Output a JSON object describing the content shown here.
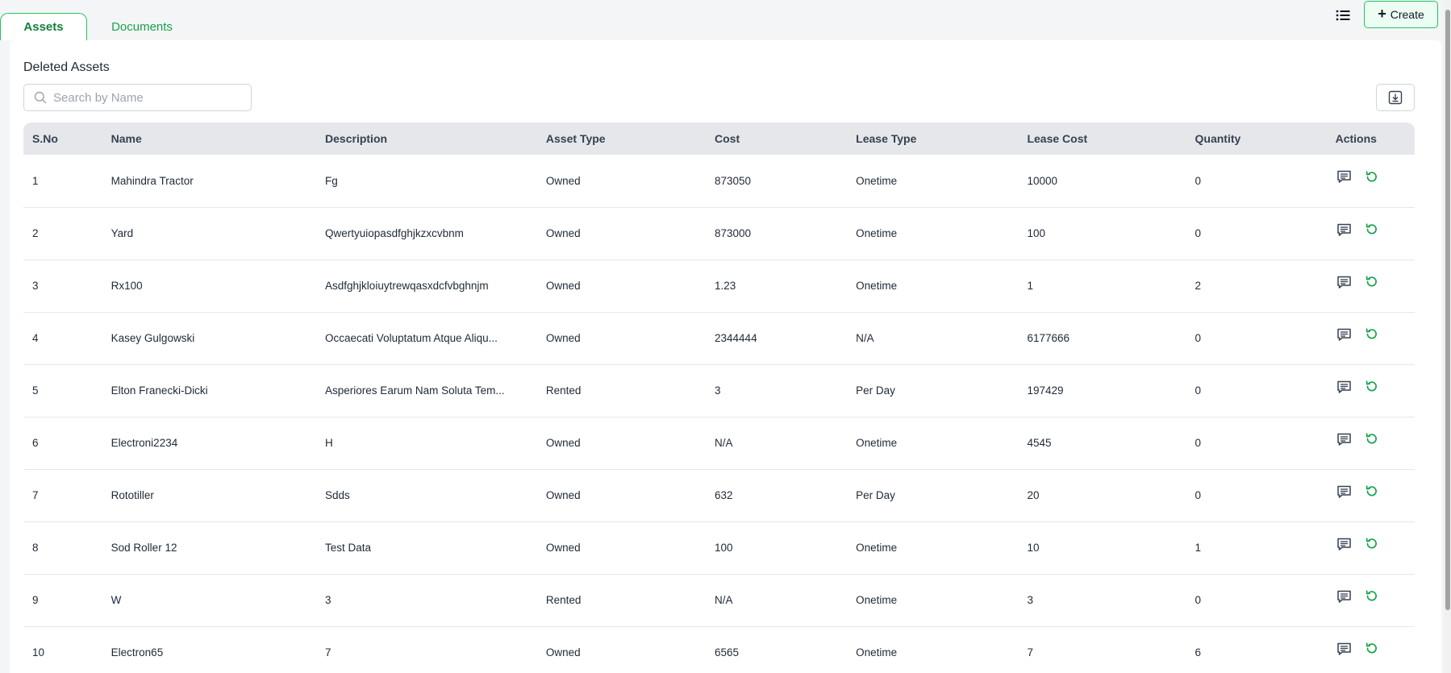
{
  "tabs": [
    {
      "label": "Assets",
      "active": true
    },
    {
      "label": "Documents",
      "active": false
    }
  ],
  "toolbar": {
    "create_label": "Create"
  },
  "panel": {
    "title": "Deleted Assets",
    "search_placeholder": "Search by Name"
  },
  "table": {
    "columns": [
      "S.No",
      "Name",
      "Description",
      "Asset Type",
      "Cost",
      "Lease Type",
      "Lease Cost",
      "Quantity",
      "Actions"
    ],
    "rows": [
      {
        "sno": "1",
        "name": "Mahindra Tractor",
        "description": "Fg",
        "asset_type": "Owned",
        "cost": "873050",
        "lease_type": "Onetime",
        "lease_cost": "10000",
        "quantity": "0"
      },
      {
        "sno": "2",
        "name": "Yard",
        "description": "Qwertyuiopasdfghjkzxcvbnm",
        "asset_type": "Owned",
        "cost": "873000",
        "lease_type": "Onetime",
        "lease_cost": "100",
        "quantity": "0"
      },
      {
        "sno": "3",
        "name": "Rx100",
        "description": "Asdfghjkloiuytrewqasxdcfvbghnjm",
        "asset_type": "Owned",
        "cost": "1.23",
        "lease_type": "Onetime",
        "lease_cost": "1",
        "quantity": "2"
      },
      {
        "sno": "4",
        "name": "Kasey Gulgowski",
        "description": "Occaecati Voluptatum Atque Aliqu...",
        "asset_type": "Owned",
        "cost": "2344444",
        "lease_type": "N/A",
        "lease_cost": "6177666",
        "quantity": "0"
      },
      {
        "sno": "5",
        "name": "Elton Franecki-Dicki",
        "description": "Asperiores Earum Nam Soluta Tem...",
        "asset_type": "Rented",
        "cost": "3",
        "lease_type": "Per Day",
        "lease_cost": "197429",
        "quantity": "0"
      },
      {
        "sno": "6",
        "name": "Electroni2234",
        "description": "H",
        "asset_type": "Owned",
        "cost": "N/A",
        "lease_type": "Onetime",
        "lease_cost": "4545",
        "quantity": "0"
      },
      {
        "sno": "7",
        "name": "Rototiller",
        "description": "Sdds",
        "asset_type": "Owned",
        "cost": "632",
        "lease_type": "Per Day",
        "lease_cost": "20",
        "quantity": "0"
      },
      {
        "sno": "8",
        "name": "Sod Roller 12",
        "description": "Test Data",
        "asset_type": "Owned",
        "cost": "100",
        "lease_type": "Onetime",
        "lease_cost": "10",
        "quantity": "1"
      },
      {
        "sno": "9",
        "name": "W",
        "description": "3",
        "asset_type": "Rented",
        "cost": "N/A",
        "lease_type": "Onetime",
        "lease_cost": "3",
        "quantity": "0"
      },
      {
        "sno": "10",
        "name": "Electron65",
        "description": "7",
        "asset_type": "Owned",
        "cost": "6565",
        "lease_type": "Onetime",
        "lease_cost": "7",
        "quantity": "6"
      }
    ],
    "row_actions": [
      "comment-icon",
      "restore-icon"
    ]
  },
  "colors": {
    "accent": "#16a34a",
    "accent_light": "#ecfdf3",
    "header_bg": "#e5e7eb",
    "page_bg": "#f4f5f7"
  }
}
